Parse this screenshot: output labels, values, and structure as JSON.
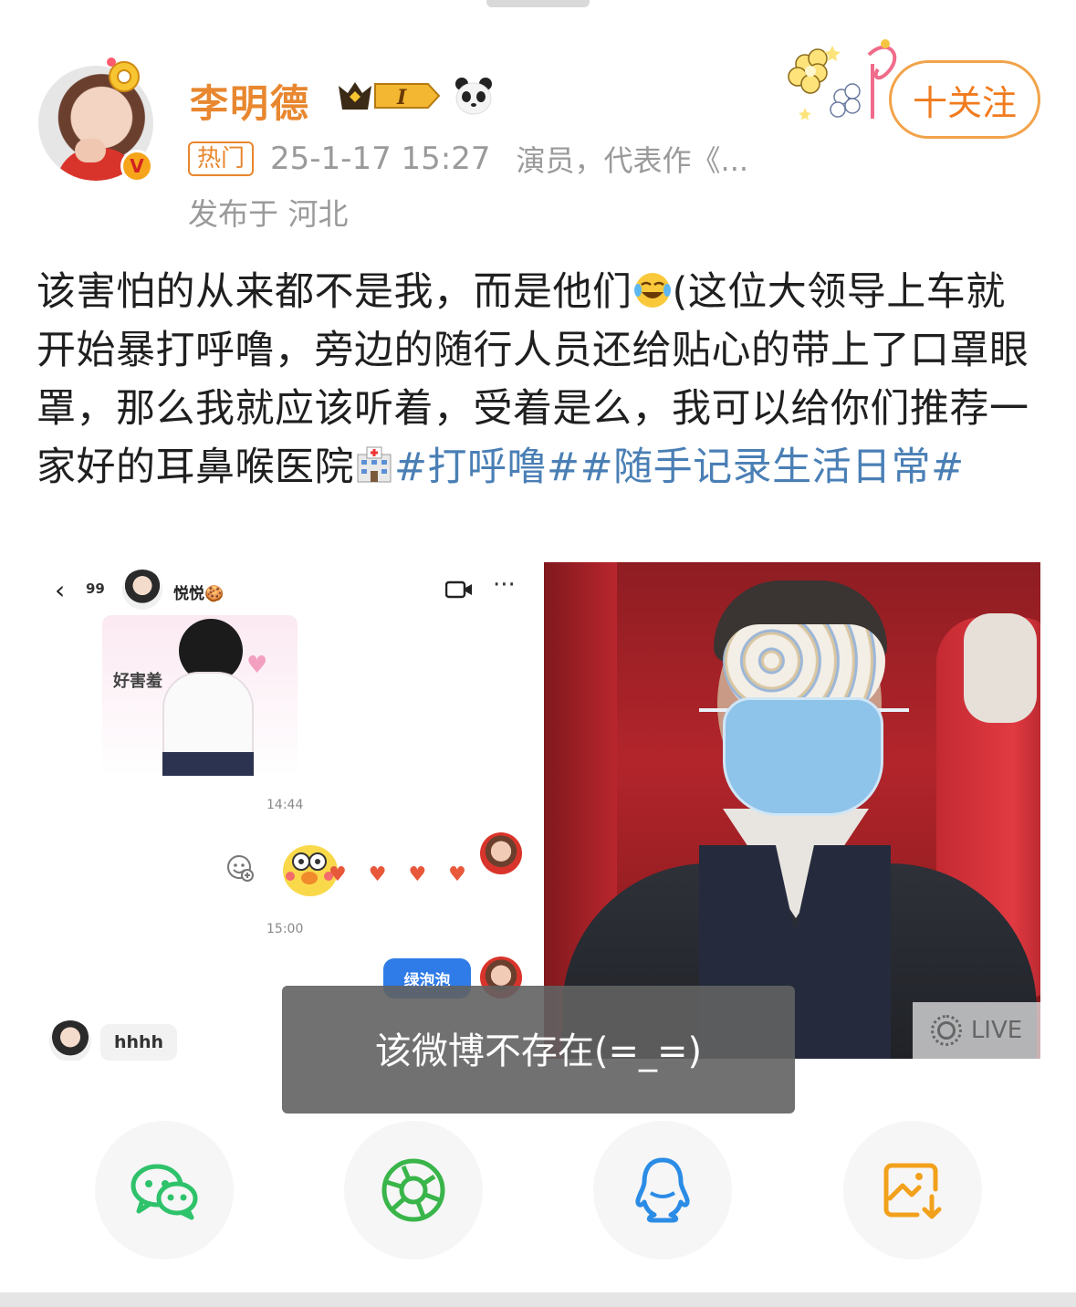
{
  "post": {
    "author_name": "李明德",
    "hot_tag": "热门",
    "timestamp": "25-1-17 15:27",
    "author_intro": "演员，代表作《...",
    "location": "发布于 河北",
    "follow_label": "十关注",
    "verified_badge": "V",
    "text_part1": "该害怕的从来都不是我，而是他们",
    "text_part2": "(这位大领导上车就开始暴打呼噜，旁边的随行人员还给贴心的带上了口罩眼罩，那么我就应该听着，受着是么，我可以给你们推荐一家好的耳鼻喉医院",
    "topic1": "#打呼噜#",
    "topic2": "#随手记录生活日常#",
    "vip_level": "I"
  },
  "chat_screenshot": {
    "back_icon": "chevron-left-icon",
    "unread_count": "99",
    "contact_name": "悦悦🍪",
    "sticker_caption": "好害羞",
    "time_1": "14:44",
    "hearts": "♥♥♥♥",
    "time_2": "15:00",
    "my_message": "绿泡泡",
    "other_message": "hhhh",
    "more_icon": "···"
  },
  "photo": {
    "live_label": "LIVE"
  },
  "toast": {
    "message": "该微博不存在(=_=)"
  },
  "share": {
    "items": [
      "wechat-icon",
      "moments-icon",
      "qq-icon",
      "save-image-icon"
    ]
  },
  "colors": {
    "username": "#e8872f",
    "topic": "#4a7fb5",
    "follow": "#f07b1e",
    "wechat": "#2ec26a",
    "moments": "#39b54a",
    "qq": "#2b8ce6",
    "save": "#f2a11c"
  }
}
